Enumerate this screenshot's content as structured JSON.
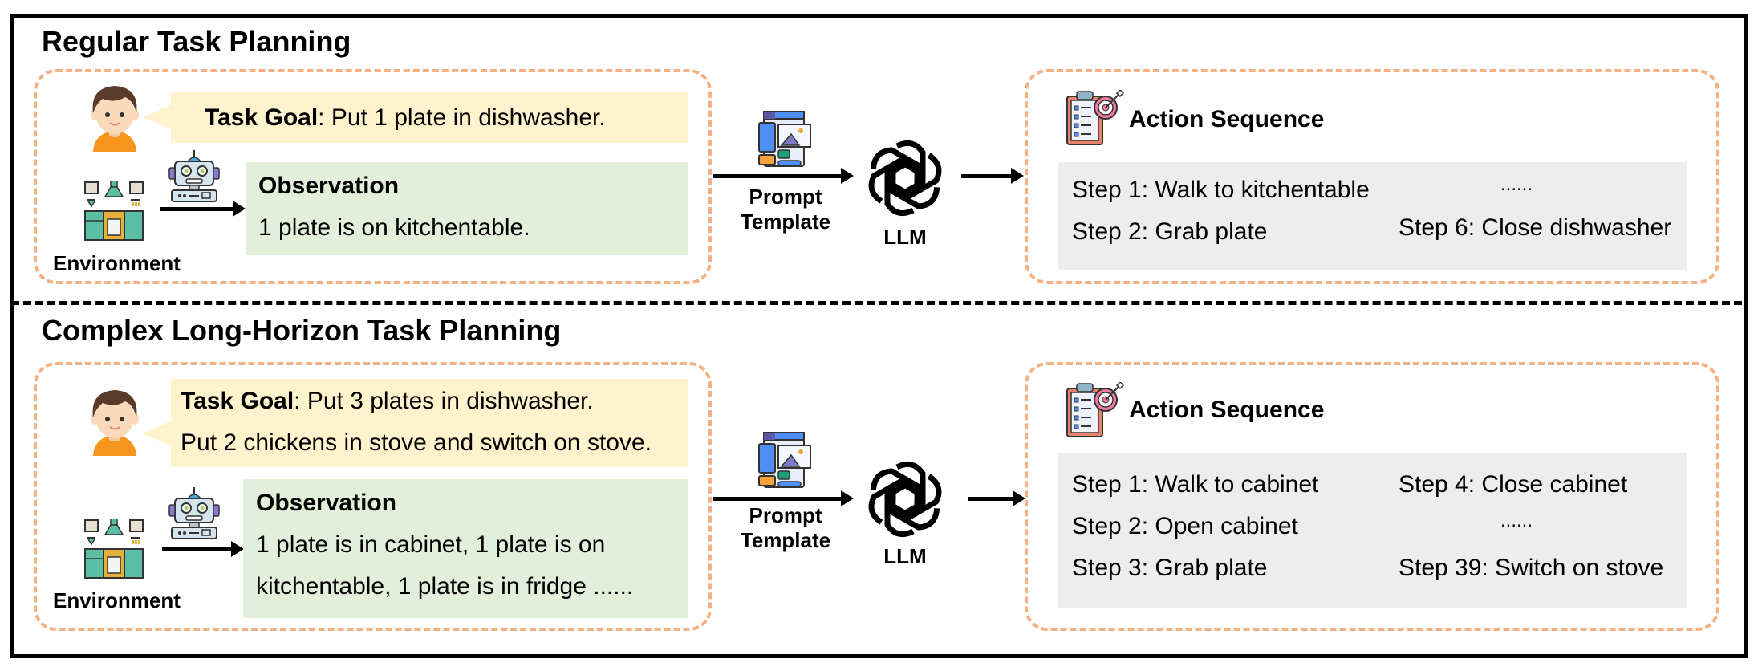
{
  "sections": [
    {
      "title": "Regular Task Planning",
      "task_goal": {
        "label": "Task Goal",
        "lines": [
          ": Put 1 plate in dishwasher."
        ]
      },
      "observation": {
        "title": "Observation",
        "lines": [
          "1 plate is on kitchentable."
        ]
      },
      "environment_label": "Environment",
      "prompt_label_1": "Prompt",
      "prompt_label_2": "Template",
      "llm_label": "LLM",
      "action_sequence": {
        "title": "Action Sequence",
        "left_steps": [
          "Step 1: Walk to kitchentable",
          "Step 2: Grab plate"
        ],
        "right_steps": [
          "......",
          "Step 6: Close dishwasher"
        ]
      }
    },
    {
      "title": "Complex Long-Horizon Task Planning",
      "task_goal": {
        "label": "Task Goal",
        "lines": [
          ": Put 3 plates in dishwasher.",
          "Put 2 chickens in stove and switch on stove."
        ]
      },
      "observation": {
        "title": "Observation",
        "lines": [
          "1 plate is in cabinet, 1 plate is on",
          "kitchentable, 1 plate is in fridge ......"
        ]
      },
      "environment_label": "Environment",
      "prompt_label_1": "Prompt",
      "prompt_label_2": "Template",
      "llm_label": "LLM",
      "action_sequence": {
        "title": "Action Sequence",
        "left_steps": [
          "Step 1: Walk to cabinet",
          "Step 2: Open cabinet",
          "Step 3: Grab plate"
        ],
        "right_steps": [
          "Step 4: Close cabinet",
          "......",
          "Step 39: Switch on stove"
        ]
      }
    }
  ],
  "colors": {
    "goal_bg": "#fff2cc",
    "observation_bg": "#e2efda",
    "steps_bg": "#ededed",
    "dashed_border": "#f4b183"
  },
  "icons": {
    "user": "user-avatar-icon",
    "robot": "robot-icon",
    "environment": "kitchen-icon",
    "prompt": "prompt-template-icon",
    "llm": "openai-logo-icon",
    "action": "clipboard-target-icon"
  }
}
